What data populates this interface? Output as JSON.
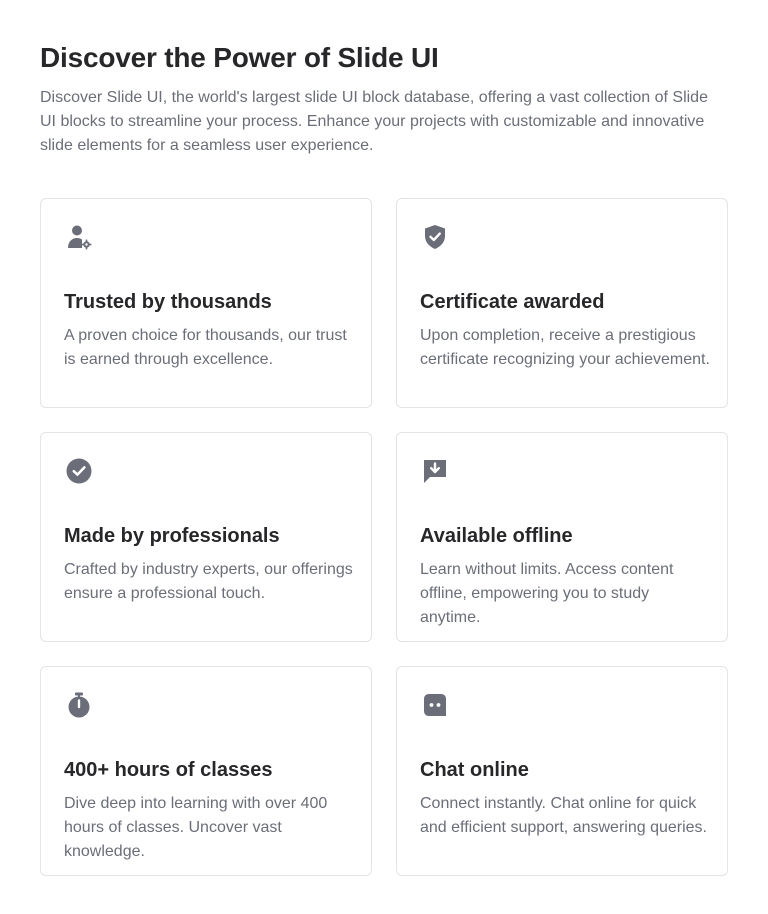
{
  "header": {
    "title": "Discover the Power of Slide UI",
    "description": "Discover Slide UI, the world's largest slide UI block database, offering a vast collection of Slide UI blocks to streamline your process. Enhance your projects with customizable and innovative slide elements for a seamless user experience."
  },
  "features": [
    {
      "icon": "user-gear-icon",
      "title": "Trusted by thousands",
      "text": "A proven choice for thousands, our trust is earned through excellence."
    },
    {
      "icon": "shield-check-icon",
      "title": "Certificate awarded",
      "text": "Upon completion, receive a prestigious certificate recognizing your achievement."
    },
    {
      "icon": "check-circle-icon",
      "title": "Made by professionals",
      "text": "Crafted by industry experts, our offerings ensure a professional touch."
    },
    {
      "icon": "download-message-icon",
      "title": "Available offline",
      "text": "Learn without limits. Access content offline, empowering you to study anytime."
    },
    {
      "icon": "stopwatch-icon",
      "title": "400+ hours of classes",
      "text": "Dive deep into learning with over 400 hours of classes. Uncover vast knowledge."
    },
    {
      "icon": "chat-bot-icon",
      "title": "Chat online",
      "text": "Connect instantly. Chat online for quick and efficient support, answering queries."
    }
  ],
  "colors": {
    "heading": "#27272a",
    "body_text": "#6b6e78",
    "icon": "#6b6e78",
    "card_border": "#e4e4e7",
    "background": "#ffffff"
  }
}
